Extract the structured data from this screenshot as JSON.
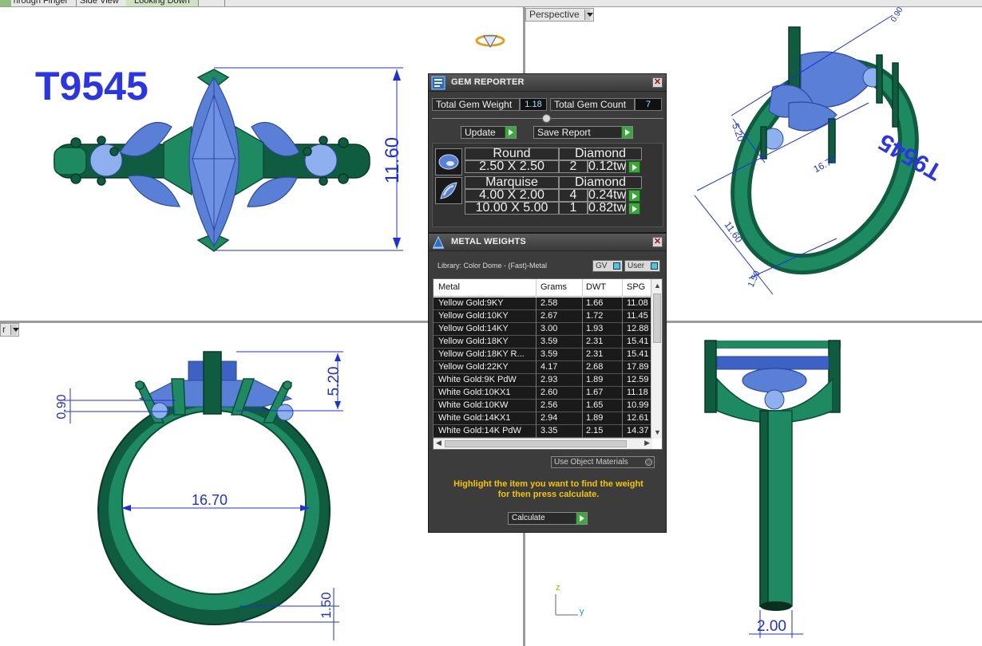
{
  "tabs": [
    {
      "label": "Through Finger"
    },
    {
      "label": "Side View"
    },
    {
      "label": "Looking Down"
    }
  ],
  "viewports": {
    "top_left": {
      "label_text": "T9545",
      "dim_height": "11.60"
    },
    "top_right": {
      "label": "Perspective",
      "dims": {
        "a": "5.20",
        "b": "16.70",
        "c": "11.60",
        "d": "1.50",
        "e": "0.90"
      },
      "engraving": "T9545"
    },
    "bottom_left": {
      "label": "r",
      "dims": {
        "height": "5.20",
        "prong": "0.90",
        "inner": "16.70",
        "band": "1.50"
      }
    },
    "bottom_right": {
      "dims": {
        "width": "2.00"
      },
      "axis_z": "z",
      "axis_y": "y"
    }
  },
  "gem_reporter": {
    "title": "GEM REPORTER",
    "total_weight_label": "Total Gem Weight",
    "total_weight_value": "1.18",
    "total_count_label": "Total Gem Count",
    "total_count_value": "7",
    "update_label": "Update",
    "save_label": "Save Report",
    "groups": [
      {
        "shape": "Round",
        "material": "Diamond",
        "rows": [
          {
            "size": "2.50 X 2.50",
            "count": "2",
            "weight": "0.12tw"
          }
        ]
      },
      {
        "shape": "Marquise",
        "material": "Diamond",
        "rows": [
          {
            "size": "4.00 X 2.00",
            "count": "4",
            "weight": "0.24tw"
          },
          {
            "size": "10.00 X 5.00",
            "count": "1",
            "weight": "0.82tw"
          }
        ]
      }
    ]
  },
  "metal_weights": {
    "title": "METAL WEIGHTS",
    "library": "Library: Color Dome - (Fast)-Metal",
    "gv_label": "GV",
    "user_label": "User",
    "columns": [
      "Metal",
      "Grams",
      "DWT",
      "SPG"
    ],
    "rows": [
      {
        "metal": "Yellow Gold:9KY",
        "grams": "2.58",
        "dwt": "1.66",
        "spg": "11.08"
      },
      {
        "metal": "Yellow Gold:10KY",
        "grams": "2.67",
        "dwt": "1.72",
        "spg": "11.45"
      },
      {
        "metal": "Yellow Gold:14KY",
        "grams": "3.00",
        "dwt": "1.93",
        "spg": "12.88"
      },
      {
        "metal": "Yellow Gold:18KY",
        "grams": "3.59",
        "dwt": "2.31",
        "spg": "15.41"
      },
      {
        "metal": "Yellow Gold:18KY R...",
        "grams": "3.59",
        "dwt": "2.31",
        "spg": "15.41"
      },
      {
        "metal": "Yellow Gold:22KY",
        "grams": "4.17",
        "dwt": "2.68",
        "spg": "17.89"
      },
      {
        "metal": "White Gold:9K PdW",
        "grams": "2.93",
        "dwt": "1.89",
        "spg": "12.59"
      },
      {
        "metal": "White Gold:10KX1",
        "grams": "2.60",
        "dwt": "1.67",
        "spg": "11.18"
      },
      {
        "metal": "White Gold:10KW",
        "grams": "2.56",
        "dwt": "1.65",
        "spg": "10.99"
      },
      {
        "metal": "White Gold:14KX1",
        "grams": "2.94",
        "dwt": "1.89",
        "spg": "12.61"
      },
      {
        "metal": "White Gold:14K PdW",
        "grams": "3.35",
        "dwt": "2.15",
        "spg": "14.37"
      }
    ],
    "use_object_materials": "Use Object Materials",
    "hint_line1": "Highlight the item you want to find the weight",
    "hint_line2": "for then press calculate.",
    "calculate_label": "Calculate"
  },
  "colors": {
    "metal_green": "#1d8a62",
    "gem_blue": "#5a7fd6",
    "dimension_blue": "#1f2fe0",
    "hint_yellow": "#f5c400"
  }
}
